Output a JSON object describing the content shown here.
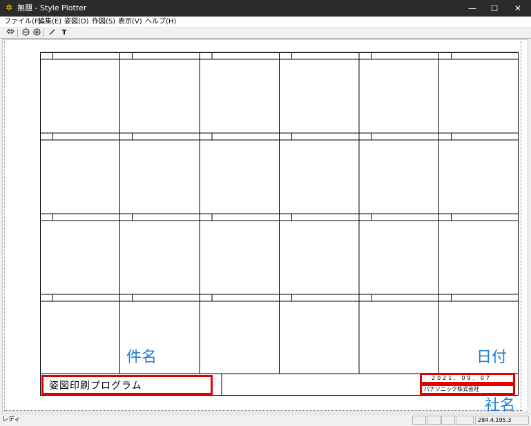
{
  "window": {
    "app_icon": "sun-logo-icon",
    "title": "無題 - Style Plotter",
    "minimize_icon": "minimize-icon",
    "maximize_icon": "maximize-icon",
    "close_icon": "close-icon"
  },
  "menubar": {
    "items": [
      "ファイル(F)",
      "編集(E)",
      "姿図(D)",
      "作図(S)",
      "表示(V)",
      "ヘルプ(H)"
    ]
  },
  "toolbar": {
    "tools": [
      "pan-icon",
      "zoom-out-icon",
      "zoom-in-icon",
      "line-icon",
      "text-icon"
    ],
    "text_tool_label": "T"
  },
  "sheet": {
    "grid": {
      "columns": 6,
      "rows": 4
    },
    "project_name": "姿図印刷プログラム",
    "date": "2021. 09. 07",
    "company": "パナソニック株式会社"
  },
  "annotations": {
    "project_label": "件名",
    "date_label": "日付",
    "company_label": "社名",
    "highlight_color": "#e00000",
    "label_color": "#1e7fd2"
  },
  "statusbar": {
    "status": "レディ",
    "coordinates": "284.4,195.3"
  }
}
